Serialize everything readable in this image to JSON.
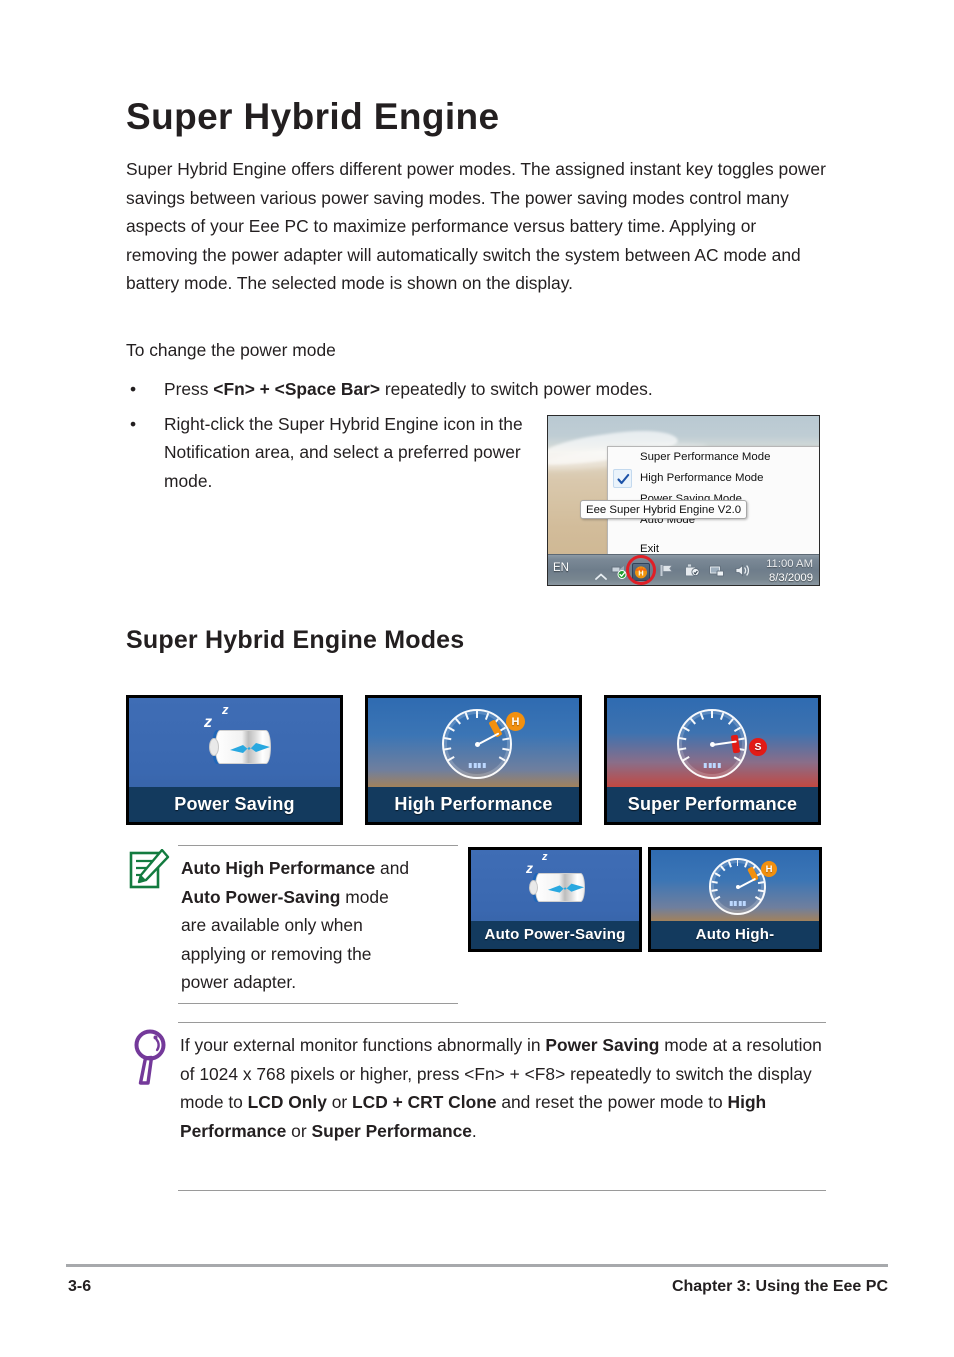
{
  "document": {
    "title": "Super Hybrid Engine",
    "intro_paragraph": "Super Hybrid Engine offers different power modes. The assigned instant key toggles power savings between various power saving modes. The power saving modes control many aspects of your Eee PC to maximize performance versus battery time. Applying or removing the power adapter will automatically switch the system between AC mode and battery mode. The selected mode is shown on the display.",
    "subhead": "To change the power mode",
    "bullets": {
      "first": {
        "bullet": "•",
        "pre": "Press ",
        "bold": "<Fn> + <Space Bar>",
        "post": " repeatedly to switch power modes."
      },
      "second": {
        "bullet": "•",
        "text": "Right-click the Super Hybrid Engine icon in the Notification area, and select a preferred power mode."
      }
    },
    "section_heading": "Super Hybrid Engine Modes"
  },
  "screenshot": {
    "context_menu": {
      "items": [
        {
          "label": "Super Performance Mode",
          "checked": false
        },
        {
          "label": "High Performance Mode",
          "checked": true
        },
        {
          "label": "Power Saving Mode",
          "checked": false
        },
        {
          "label": "Auto Mode",
          "checked": false
        },
        {
          "label": "Exit",
          "checked": false
        }
      ],
      "checkmark_icon": "check-icon"
    },
    "tooltip_text": "Eee Super Hybrid Engine V2.0",
    "taskbar": {
      "language": "EN",
      "show_hidden_icons": "chevron-up-icon",
      "tray_icons": [
        "network-ok-icon",
        "super-hybrid-engine-icon",
        "flag-icon",
        "safely-remove-hardware-icon",
        "display-icon",
        "volume-icon"
      ],
      "clock_time": "11:00 AM",
      "clock_date": "8/3/2009"
    },
    "highlight_color": "#e01f26"
  },
  "modes": {
    "primary": [
      {
        "label": "Power Saving",
        "icon": "sleeping-battery-icon",
        "art": "blue"
      },
      {
        "label": "High Performance",
        "icon": "gauge-high-icon",
        "art": "orange",
        "badge": "H",
        "badge_color": "#f2900f"
      },
      {
        "label": "Super Performance",
        "icon": "gauge-super-icon",
        "art": "red",
        "badge": "S",
        "badge_color": "#e21b16"
      }
    ],
    "auto": [
      {
        "label": "Auto Power-Saving",
        "icon": "sleeping-battery-icon",
        "art": "blue"
      },
      {
        "label": "Auto High-Performance",
        "icon": "gauge-high-icon",
        "art": "orange",
        "badge": "H",
        "badge_color": "#f2900f"
      }
    ],
    "z_letters": [
      "z",
      "z"
    ]
  },
  "note_box": {
    "icon": "note-pencil-icon",
    "icon_color": "#137b3f",
    "lines": [
      {
        "bold": "Auto High Performance",
        "rest": " and"
      },
      {
        "bold": "Auto Power-Saving",
        "rest": " mode"
      },
      {
        "bold": "",
        "rest": "are available only when"
      },
      {
        "bold": "",
        "rest": "applying or removing the"
      },
      {
        "bold": "",
        "rest": "power adapter."
      }
    ]
  },
  "tip_box": {
    "icon": "magnifier-icon",
    "icon_color": "#74399a",
    "segments": [
      {
        "text": "If your external monitor functions abnormally in ",
        "bold": false
      },
      {
        "text": "Power Saving",
        "bold": true
      },
      {
        "text": " mode at a resolution of 1024 x 768 pixels or higher, press <Fn> + <F8> repeatedly to switch the display mode to ",
        "bold": false
      },
      {
        "text": "LCD Only",
        "bold": true
      },
      {
        "text": " or ",
        "bold": false
      },
      {
        "text": "LCD + CRT Clone",
        "bold": true
      },
      {
        "text": " and reset the power mode to ",
        "bold": false
      },
      {
        "text": "High Performance",
        "bold": true
      },
      {
        "text": " or ",
        "bold": false
      },
      {
        "text": "Super Performance",
        "bold": true
      },
      {
        "text": ".",
        "bold": false
      }
    ]
  },
  "footer": {
    "page_number": "3-6",
    "chapter": "Chapter 3: Using the Eee PC"
  }
}
